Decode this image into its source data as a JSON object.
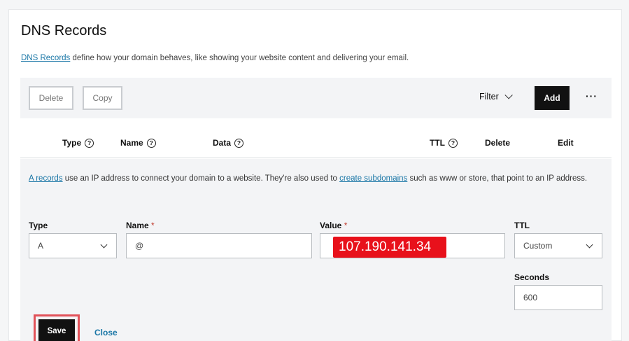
{
  "page": {
    "title": "DNS Records",
    "description_link": "DNS Records",
    "description_rest": " define how your domain behaves, like showing your website content and delivering your email."
  },
  "toolbar": {
    "delete_label": "Delete",
    "copy_label": "Copy",
    "filter_label": "Filter",
    "add_label": "Add",
    "more_label": "···"
  },
  "table": {
    "columns": [
      "Type",
      "Name",
      "Data",
      "TTL",
      "Delete",
      "Edit"
    ]
  },
  "edit": {
    "info_link1": "A records",
    "info_text1": " use an IP address to connect your domain to a website. They're also used to ",
    "info_link2": "create subdomains",
    "info_text2": " such as www or store, that point to an IP address.",
    "type_label": "Type",
    "type_value": "A",
    "name_label": "Name",
    "name_value": "@",
    "value_label": "Value",
    "value_value": "107.190.141.34",
    "required_mark": "*",
    "ttl_label": "TTL",
    "ttl_value": "Custom",
    "seconds_label": "Seconds",
    "seconds_value": "600",
    "save_label": "Save",
    "close_label": "Close"
  },
  "colors": {
    "accent_link": "#1976a6",
    "primary_button": "#111111",
    "redaction": "#e8111b",
    "highlight_outline": "#e15259"
  }
}
